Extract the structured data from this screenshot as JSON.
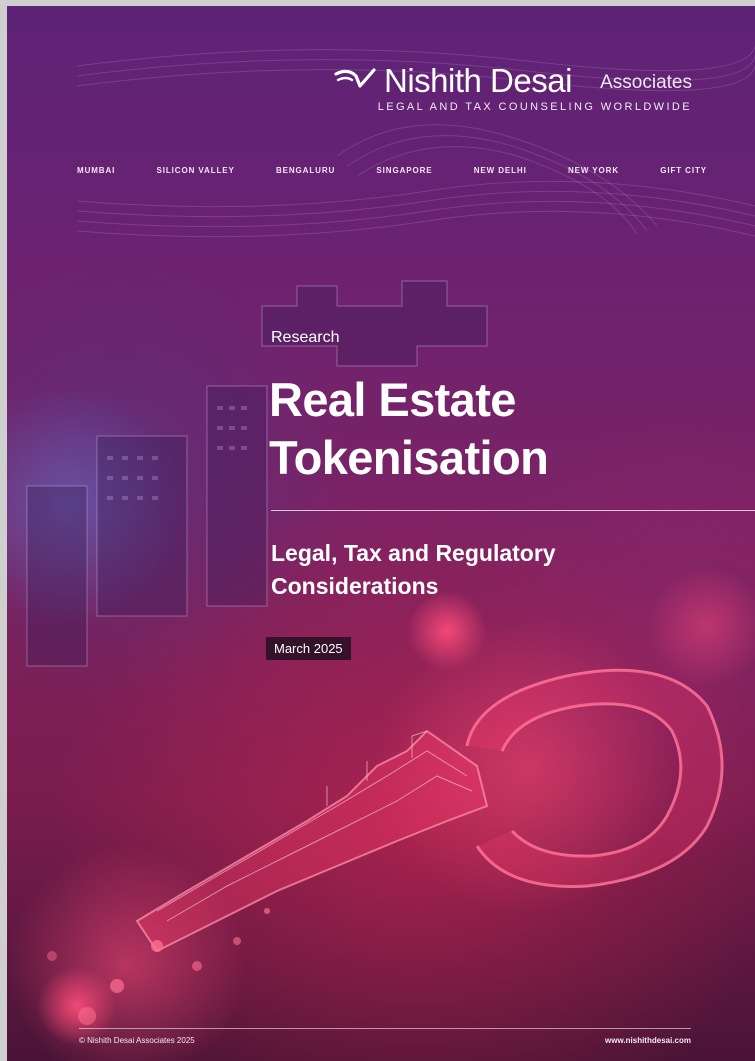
{
  "brand": {
    "name": "Nishith Desai",
    "suffix": "Associates",
    "tagline": "LEGAL AND TAX COUNSELING WORLDWIDE"
  },
  "cities": [
    "MUMBAI",
    "SILICON VALLEY",
    "BENGALURU",
    "SINGAPORE",
    "NEW DELHI",
    "NEW YORK",
    "GIFT CITY"
  ],
  "cover": {
    "eyebrow": "Research",
    "title_line1": "Real Estate",
    "title_line2": "Tokenisation",
    "subtitle_line1": "Legal, Tax and Regulatory",
    "subtitle_line2": "Considerations",
    "date": "March 2025"
  },
  "footer": {
    "copyright": "© Nishith Desai Associates 2025",
    "website": "www.nishithdesai.com"
  },
  "colors": {
    "background_top": "#5e2376",
    "background_bottom": "#4a1436",
    "accent_glow": "#e0305a",
    "text": "#ffffff"
  },
  "icons": {
    "brand_mark": "nda-swoosh-icon",
    "background_art": "digital-key-icon"
  }
}
